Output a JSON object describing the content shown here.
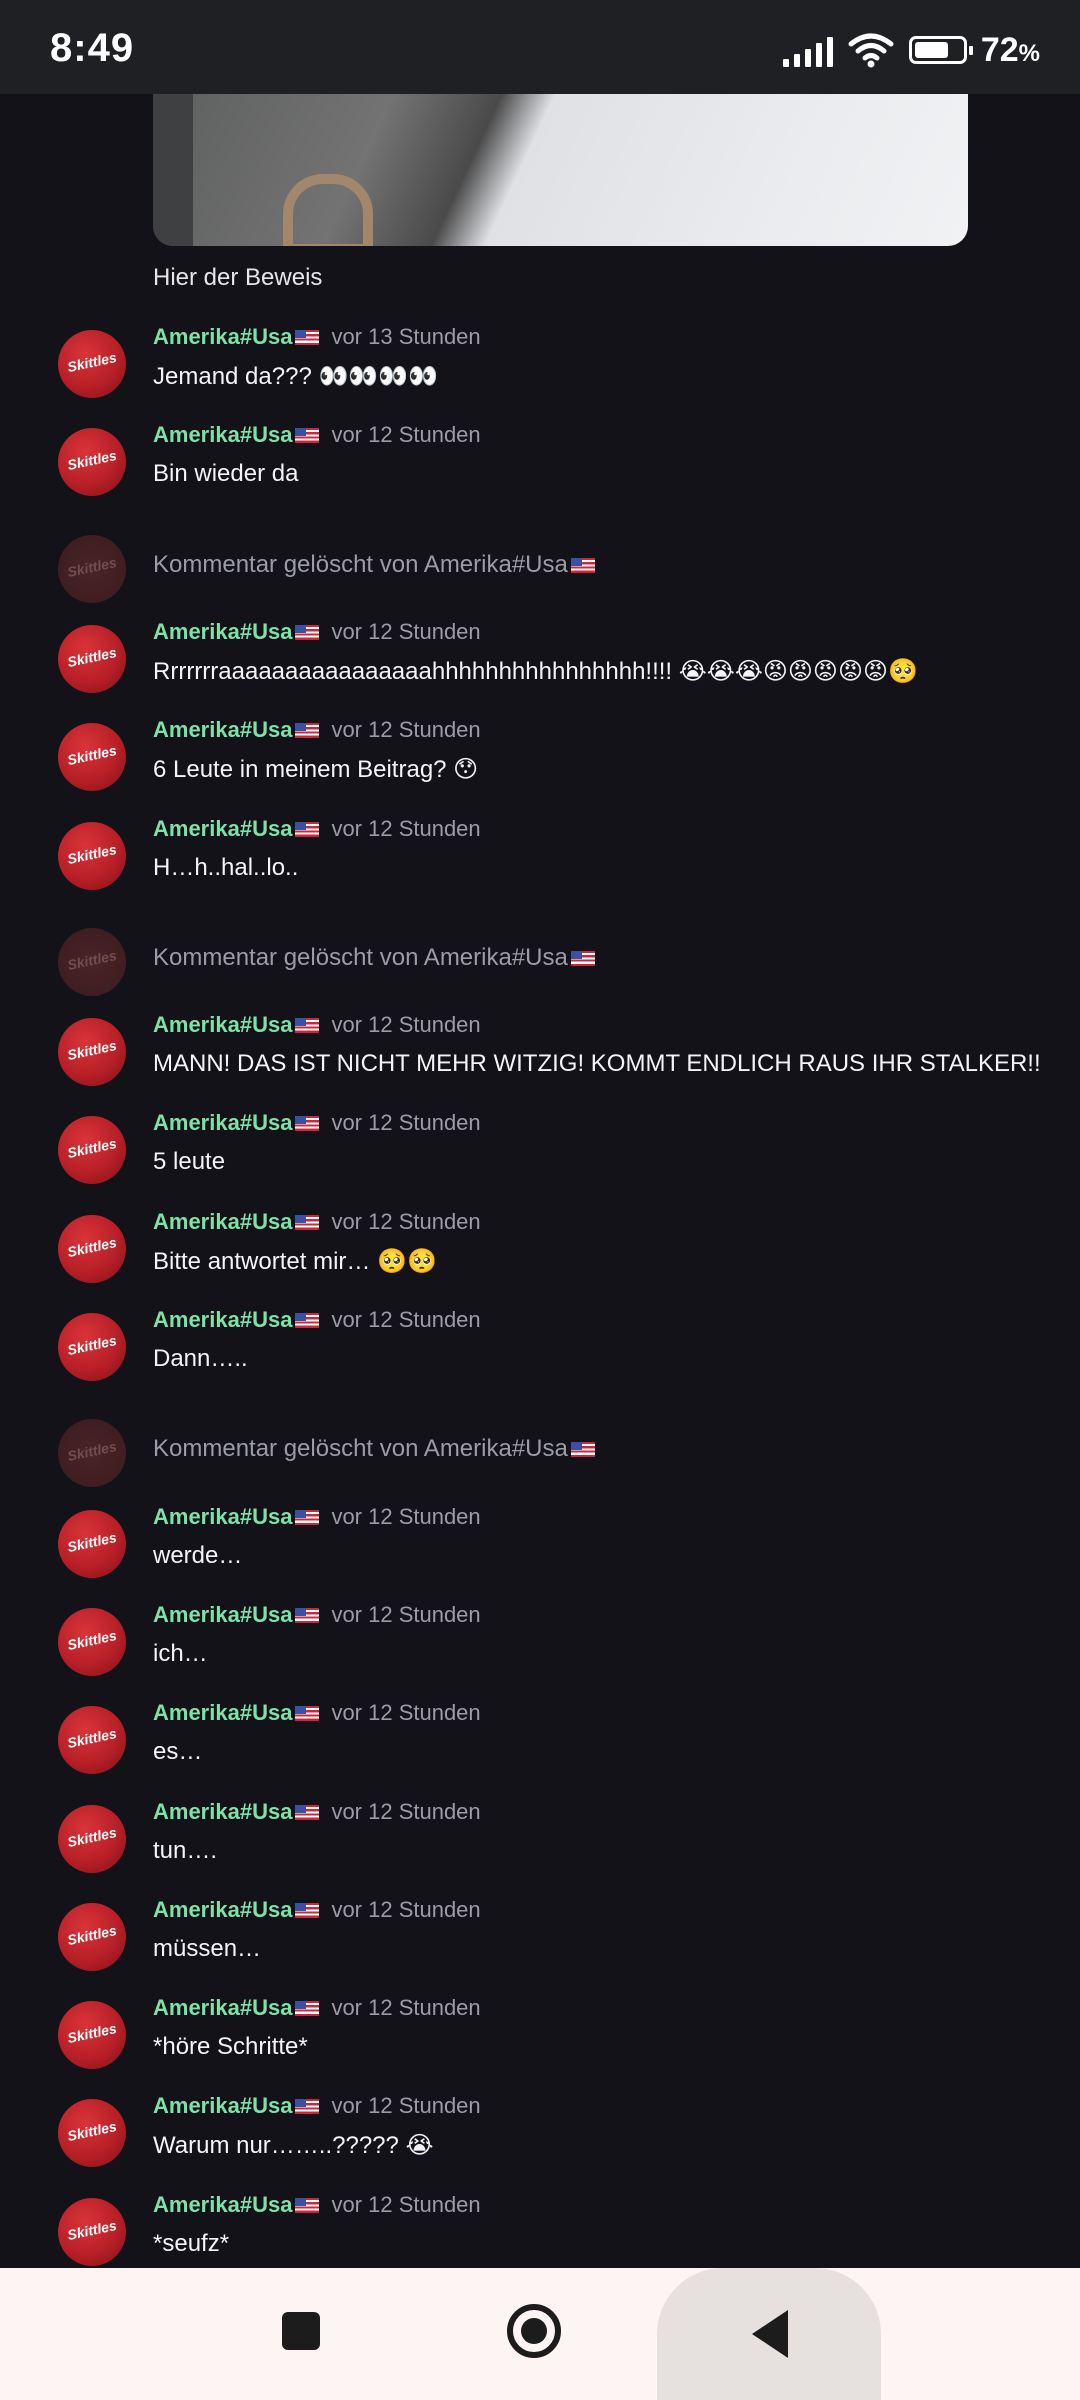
{
  "status_bar": {
    "time": "8:49",
    "battery_percent": "72",
    "battery_unit": "%",
    "battery_level": 0.72
  },
  "post": {
    "caption": "Hier der Beweis"
  },
  "avatar_label": "Skittles",
  "flag_icon": "us-flag-icon",
  "comments": [
    {
      "user": "Amerika#Usa",
      "time": "vor 13 Stunden",
      "text": "Jemand da??? 👀👀👀👀"
    },
    {
      "user": "Amerika#Usa",
      "time": "vor 12 Stunden",
      "text": "Bin wieder da"
    },
    {
      "deleted": true,
      "text": "Kommentar gelöscht von Amerika#Usa"
    },
    {
      "user": "Amerika#Usa",
      "time": "vor 12 Stunden",
      "text": "Rrrrrrraaaaaaaaaaaaaaaahhhhhhhhhhhhhhhh!!!! 😭😭😭😡😡😡😡😡🥺"
    },
    {
      "user": "Amerika#Usa",
      "time": "vor 12 Stunden",
      "text": "6 Leute in meinem Beitrag? 😯"
    },
    {
      "user": "Amerika#Usa",
      "time": "vor 12 Stunden",
      "text": "H…h..hal..lo.."
    },
    {
      "deleted": true,
      "text": "Kommentar gelöscht von Amerika#Usa"
    },
    {
      "user": "Amerika#Usa",
      "time": "vor 12 Stunden",
      "text": "MANN! DAS IST NICHT MEHR WITZIG! KOMMT ENDLICH RAUS IHR STALKER!!"
    },
    {
      "user": "Amerika#Usa",
      "time": "vor 12 Stunden",
      "text": "5 leute"
    },
    {
      "user": "Amerika#Usa",
      "time": "vor 12 Stunden",
      "text": "Bitte antwortet mir… 🥺🥺"
    },
    {
      "user": "Amerika#Usa",
      "time": "vor 12 Stunden",
      "text": "Dann….."
    },
    {
      "deleted": true,
      "text": "Kommentar gelöscht von Amerika#Usa"
    },
    {
      "user": "Amerika#Usa",
      "time": "vor 12 Stunden",
      "text": "werde…"
    },
    {
      "user": "Amerika#Usa",
      "time": "vor 12 Stunden",
      "text": "ich…"
    },
    {
      "user": "Amerika#Usa",
      "time": "vor 12 Stunden",
      "text": "es…"
    },
    {
      "user": "Amerika#Usa",
      "time": "vor 12 Stunden",
      "text": "tun…."
    },
    {
      "user": "Amerika#Usa",
      "time": "vor 12 Stunden",
      "text": "müssen…"
    },
    {
      "user": "Amerika#Usa",
      "time": "vor 12 Stunden",
      "text": "*höre Schritte*"
    },
    {
      "user": "Amerika#Usa",
      "time": "vor 12 Stunden",
      "text": "Warum nur……..????? 😭"
    },
    {
      "user": "Amerika#Usa",
      "time": "vor 12 Stunden",
      "text": "*seufz*"
    }
  ],
  "nav_bar": {
    "recents": "square-icon",
    "home": "circle-home-icon",
    "back": "back-triangle-icon"
  }
}
